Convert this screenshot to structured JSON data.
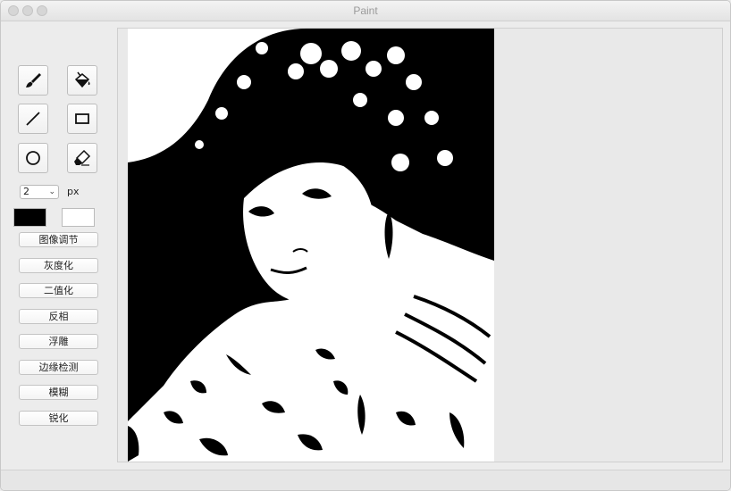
{
  "window": {
    "title": "Paint"
  },
  "toolbar": {
    "tools": [
      {
        "name": "brush-icon"
      },
      {
        "name": "fill-bucket-icon"
      },
      {
        "name": "line-icon"
      },
      {
        "name": "rectangle-icon"
      },
      {
        "name": "ellipse-icon"
      },
      {
        "name": "eraser-icon"
      }
    ],
    "size_value": "2",
    "size_unit": "px",
    "foreground_color": "#000000",
    "background_color": "#ffffff"
  },
  "actions": [
    {
      "id": "image-adjust",
      "label": "图像调节"
    },
    {
      "id": "grayscale",
      "label": "灰度化"
    },
    {
      "id": "binarize",
      "label": "二值化"
    },
    {
      "id": "invert",
      "label": "反相"
    },
    {
      "id": "emboss",
      "label": "浮雕"
    },
    {
      "id": "edge-detect",
      "label": "边缘检测"
    },
    {
      "id": "blur",
      "label": "模糊"
    },
    {
      "id": "sharpen",
      "label": "锐化"
    }
  ]
}
